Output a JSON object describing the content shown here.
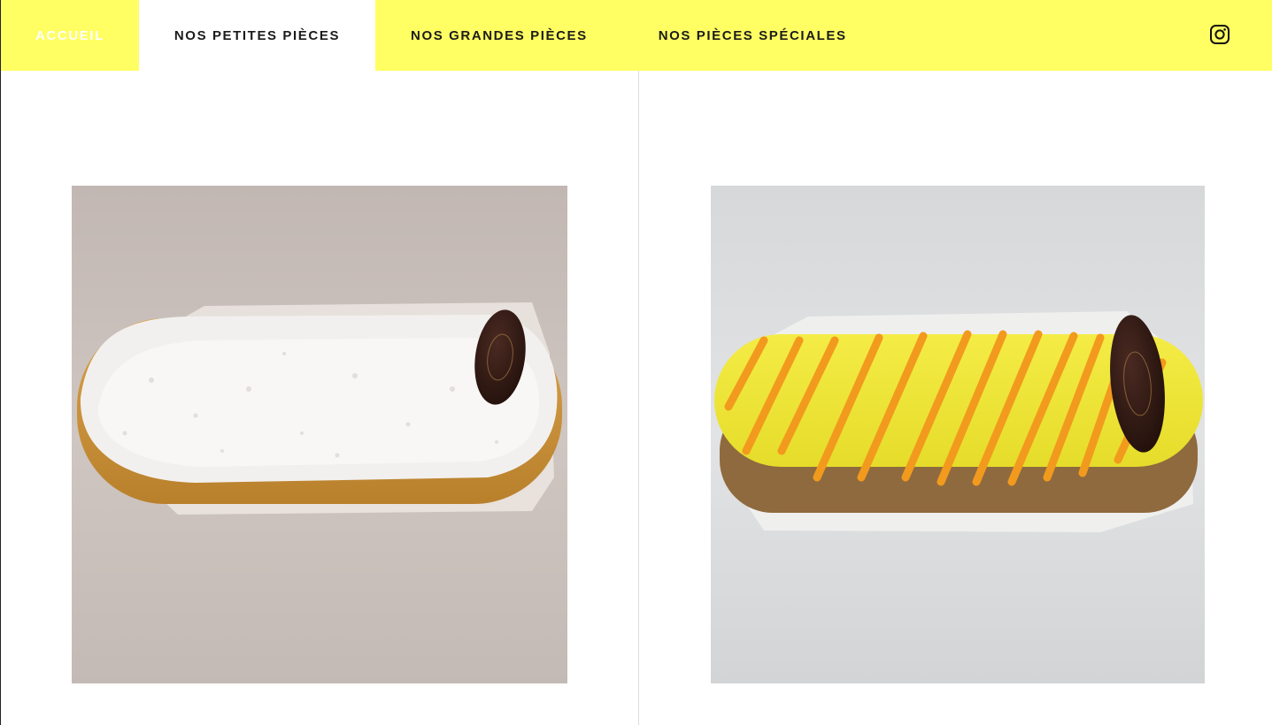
{
  "nav": {
    "items": [
      {
        "label": "ACCUEIL",
        "state": "home"
      },
      {
        "label": "NOS PETITES PIÈCES",
        "state": "active"
      },
      {
        "label": "NOS GRANDES PIÈCES",
        "state": "normal"
      },
      {
        "label": "NOS PIÈCES SPÉCIALES",
        "state": "normal"
      }
    ],
    "social_icon": "instagram-icon",
    "background_color": "#ffff63"
  },
  "gallery": {
    "items": [
      {
        "image": "coconut-eclair-photo",
        "description": "éclair topped with shredded coconut and a chocolate disc"
      },
      {
        "image": "mango-eclair-photo",
        "description": "éclair with yellow glaze, orange drizzle and a chocolate disc"
      }
    ]
  }
}
